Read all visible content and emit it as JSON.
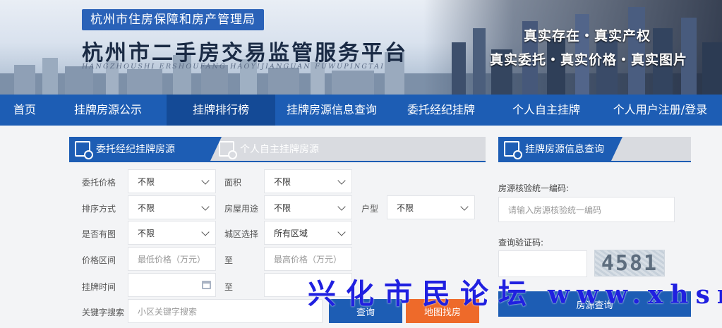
{
  "banner": {
    "bureau": "杭州市住房保障和房产管理局",
    "platform": "杭州市二手房交易监管服务平台",
    "pinyin": "HANGZHOUSHI  ERSHOUFANG  HAOYIJIANGUAN  FUWUPINGTAI",
    "slogan_line1": "真实存在・真实产权",
    "slogan_line2": "真实委托・真实价格・真实图片"
  },
  "nav": {
    "items": [
      {
        "label": "首页"
      },
      {
        "label": "挂牌房源公示"
      },
      {
        "label": "挂牌排行榜"
      },
      {
        "label": "挂牌房源信息查询"
      },
      {
        "label": "委托经纪挂牌"
      },
      {
        "label": "个人自主挂牌"
      },
      {
        "label": "个人用户注册/登录"
      }
    ],
    "active_index": 2
  },
  "search": {
    "tab_agent": "委托经纪挂牌房源",
    "tab_personal": "个人自主挂牌房源",
    "labels": {
      "price": "委托价格",
      "area": "面积",
      "sort": "排序方式",
      "usage": "房屋用途",
      "layout": "户型",
      "has_image": "是否有图",
      "district": "城区选择",
      "price_range": "价格区间",
      "to1": "至",
      "listing_time": "挂牌时间",
      "to2": "至",
      "keyword": "关键字搜索"
    },
    "values": {
      "price": "不限",
      "area": "不限",
      "sort": "不限",
      "usage": "不限",
      "layout": "不限",
      "has_image": "不限",
      "district": "所有区域"
    },
    "placeholders": {
      "min_price": "最低价格（万元）",
      "max_price": "最高价格（万元）",
      "keyword": "小区关键字搜索"
    },
    "btn_search": "查询",
    "btn_map": "地图找房"
  },
  "query": {
    "title": "挂牌房源信息查询",
    "code_label": "房源核验统一编码:",
    "code_placeholder": "请输入房源核验统一编码",
    "captcha_label": "查询验证码:",
    "captcha_text": "4581",
    "btn_query": "房源查询"
  },
  "watermark": {
    "cn": "兴化市民论坛",
    "url": "www.xhsmlt.com"
  },
  "colors": {
    "primary": "#1d5db4",
    "nav_active": "#144a96",
    "map_button": "#ee6a2a",
    "watermark": "#2020e0"
  }
}
